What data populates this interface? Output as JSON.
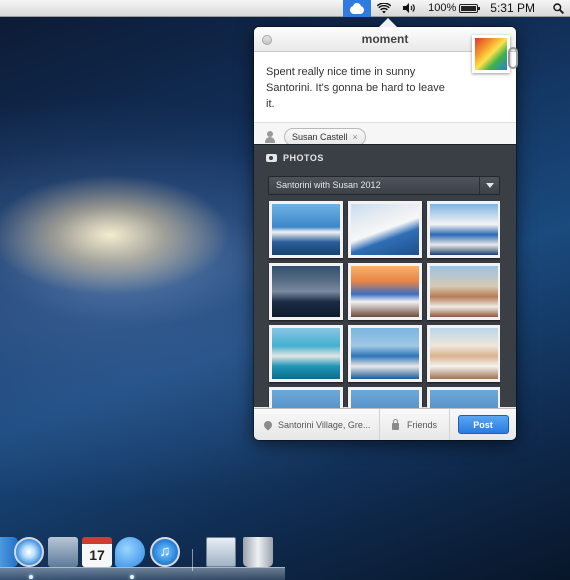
{
  "menubar": {
    "battery": "100%",
    "time": "5:31 PM"
  },
  "popover": {
    "title": "moment",
    "message": "Spent really nice time in sunny Santorini. It's gonna be hard to leave it.",
    "tag": {
      "name": "Susan Castell",
      "remove": "×"
    },
    "photos": {
      "heading": "PHOTOS",
      "album": "Santorini with Susan 2012",
      "items": [
        {
          "name": "photo-1"
        },
        {
          "name": "photo-2"
        },
        {
          "name": "photo-3"
        },
        {
          "name": "photo-4"
        },
        {
          "name": "photo-5"
        },
        {
          "name": "photo-6"
        },
        {
          "name": "photo-7"
        },
        {
          "name": "photo-8"
        },
        {
          "name": "photo-9"
        }
      ]
    },
    "footer": {
      "location": "Santorini Village, Gre...",
      "privacy": "Friends",
      "post": "Post"
    }
  },
  "dock": {
    "calendar_day": "17"
  },
  "colors": {
    "accent": "#2f7be0",
    "post_button": "#2a7be0",
    "photos_panel": "#3a3e45"
  }
}
